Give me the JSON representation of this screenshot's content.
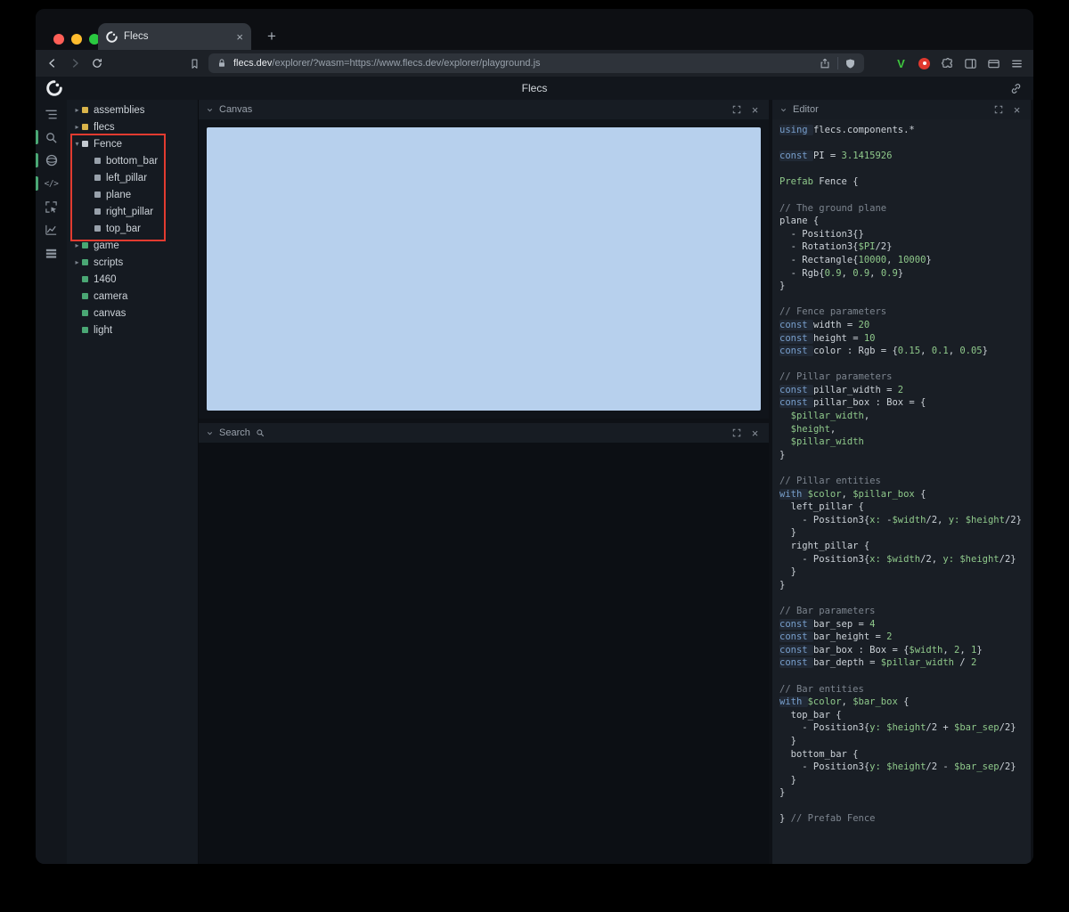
{
  "browser": {
    "tab_title": "Flecs",
    "tab_close_label": "×",
    "new_tab_label": "+",
    "url_domain": "flecs.dev",
    "url_path": "/explorer/?wasm=https://www.flecs.dev/explorer/playground.js",
    "v_extension_label": "V"
  },
  "app": {
    "title": "Flecs"
  },
  "iconbar": [
    {
      "name": "tree-icon",
      "active": false
    },
    {
      "name": "search-icon",
      "active": true
    },
    {
      "name": "scene-icon",
      "active": true
    },
    {
      "name": "code-icon",
      "active": true
    },
    {
      "name": "inspect-icon",
      "active": false
    },
    {
      "name": "chart-icon",
      "active": false
    },
    {
      "name": "rows-icon",
      "active": false
    }
  ],
  "tree": [
    {
      "label": "assemblies",
      "kind": "module",
      "arrow": "collapsed",
      "depth": 0
    },
    {
      "label": "flecs",
      "kind": "module",
      "arrow": "collapsed",
      "depth": 0
    },
    {
      "label": "Fence",
      "kind": "prefab",
      "arrow": "expanded",
      "depth": 0
    },
    {
      "label": "bottom_bar",
      "kind": "child",
      "arrow": "leaf",
      "depth": 1
    },
    {
      "label": "left_pillar",
      "kind": "child",
      "arrow": "leaf",
      "depth": 1
    },
    {
      "label": "plane",
      "kind": "child",
      "arrow": "leaf",
      "depth": 1
    },
    {
      "label": "right_pillar",
      "kind": "child",
      "arrow": "leaf",
      "depth": 1
    },
    {
      "label": "top_bar",
      "kind": "child",
      "arrow": "leaf",
      "depth": 1
    },
    {
      "label": "game",
      "kind": "entity",
      "arrow": "collapsed",
      "depth": 0
    },
    {
      "label": "scripts",
      "kind": "entity",
      "arrow": "collapsed",
      "depth": 0
    },
    {
      "label": "1460",
      "kind": "entity",
      "arrow": "leaf",
      "depth": 0
    },
    {
      "label": "camera",
      "kind": "entity",
      "arrow": "leaf",
      "depth": 0
    },
    {
      "label": "canvas",
      "kind": "entity",
      "arrow": "leaf",
      "depth": 0
    },
    {
      "label": "light",
      "kind": "entity",
      "arrow": "leaf",
      "depth": 0
    }
  ],
  "panels": {
    "canvas": {
      "title": "Canvas"
    },
    "search": {
      "title": "Search"
    },
    "editor": {
      "title": "Editor"
    },
    "close_label": "×"
  },
  "colors": {
    "canvas_bg": "#b7d0ed",
    "annotation": "#e23b30",
    "module_square": "#d9b44a",
    "prefab_square": "#c3c9d0",
    "child_square": "#98a1ab",
    "entity_square": "#4aa774"
  },
  "code": [
    [
      [
        "k",
        "using "
      ],
      [
        "p",
        "flecs.components.*"
      ]
    ],
    [],
    [
      [
        "k",
        "const "
      ],
      [
        "p",
        "PI = "
      ],
      [
        "n",
        "3.1415926"
      ]
    ],
    [],
    [
      [
        "g",
        "Prefab "
      ],
      [
        "p",
        "Fence {"
      ]
    ],
    [],
    [
      [
        "c",
        "// The ground plane"
      ]
    ],
    [
      [
        "p",
        "plane {"
      ]
    ],
    [
      [
        "p",
        "  - Position3{}"
      ]
    ],
    [
      [
        "p",
        "  - Rotation3{"
      ],
      [
        "v",
        "$PI"
      ],
      [
        "p",
        "/2}"
      ]
    ],
    [
      [
        "p",
        "  - Rectangle{"
      ],
      [
        "n",
        "10000"
      ],
      [
        "p",
        ", "
      ],
      [
        "n",
        "10000"
      ],
      [
        "p",
        "}"
      ]
    ],
    [
      [
        "p",
        "  - Rgb{"
      ],
      [
        "n",
        "0.9"
      ],
      [
        "p",
        ", "
      ],
      [
        "n",
        "0.9"
      ],
      [
        "p",
        ", "
      ],
      [
        "n",
        "0.9"
      ],
      [
        "p",
        "}"
      ]
    ],
    [
      [
        "p",
        "}"
      ]
    ],
    [],
    [
      [
        "c",
        "// Fence parameters"
      ]
    ],
    [
      [
        "k",
        "const "
      ],
      [
        "p",
        "width = "
      ],
      [
        "n",
        "20"
      ]
    ],
    [
      [
        "k",
        "const "
      ],
      [
        "p",
        "height = "
      ],
      [
        "n",
        "10"
      ]
    ],
    [
      [
        "k",
        "const "
      ],
      [
        "p",
        "color : Rgb = {"
      ],
      [
        "n",
        "0.15"
      ],
      [
        "p",
        ", "
      ],
      [
        "n",
        "0.1"
      ],
      [
        "p",
        ", "
      ],
      [
        "n",
        "0.05"
      ],
      [
        "p",
        "}"
      ]
    ],
    [],
    [
      [
        "c",
        "// Pillar parameters"
      ]
    ],
    [
      [
        "k",
        "const "
      ],
      [
        "p",
        "pillar_width = "
      ],
      [
        "n",
        "2"
      ]
    ],
    [
      [
        "k",
        "const "
      ],
      [
        "p",
        "pillar_box : Box = {"
      ]
    ],
    [
      [
        "p",
        "  "
      ],
      [
        "v",
        "$pillar_width"
      ],
      [
        "p",
        ","
      ]
    ],
    [
      [
        "p",
        "  "
      ],
      [
        "v",
        "$height"
      ],
      [
        "p",
        ","
      ]
    ],
    [
      [
        "p",
        "  "
      ],
      [
        "v",
        "$pillar_width"
      ]
    ],
    [
      [
        "p",
        "}"
      ]
    ],
    [],
    [
      [
        "c",
        "// Pillar entities"
      ]
    ],
    [
      [
        "k",
        "with "
      ],
      [
        "v",
        "$color"
      ],
      [
        "p",
        ", "
      ],
      [
        "v",
        "$pillar_box"
      ],
      [
        "p",
        " {"
      ]
    ],
    [
      [
        "p",
        "  left_pillar {"
      ]
    ],
    [
      [
        "p",
        "    - Position3{"
      ],
      [
        "v",
        "x:"
      ],
      [
        "p",
        " -"
      ],
      [
        "v",
        "$width"
      ],
      [
        "p",
        "/2, "
      ],
      [
        "v",
        "y:"
      ],
      [
        "p",
        " "
      ],
      [
        "v",
        "$height"
      ],
      [
        "p",
        "/2}"
      ]
    ],
    [
      [
        "p",
        "  }"
      ]
    ],
    [
      [
        "p",
        "  right_pillar {"
      ]
    ],
    [
      [
        "p",
        "    - Position3{"
      ],
      [
        "v",
        "x:"
      ],
      [
        "p",
        " "
      ],
      [
        "v",
        "$width"
      ],
      [
        "p",
        "/2, "
      ],
      [
        "v",
        "y:"
      ],
      [
        "p",
        " "
      ],
      [
        "v",
        "$height"
      ],
      [
        "p",
        "/2}"
      ]
    ],
    [
      [
        "p",
        "  }"
      ]
    ],
    [
      [
        "p",
        "}"
      ]
    ],
    [],
    [
      [
        "c",
        "// Bar parameters"
      ]
    ],
    [
      [
        "k",
        "const "
      ],
      [
        "p",
        "bar_sep = "
      ],
      [
        "n",
        "4"
      ]
    ],
    [
      [
        "k",
        "const "
      ],
      [
        "p",
        "bar_height = "
      ],
      [
        "n",
        "2"
      ]
    ],
    [
      [
        "k",
        "const "
      ],
      [
        "p",
        "bar_box : Box = {"
      ],
      [
        "v",
        "$width"
      ],
      [
        "p",
        ", "
      ],
      [
        "n",
        "2"
      ],
      [
        "p",
        ", "
      ],
      [
        "n",
        "1"
      ],
      [
        "p",
        "}"
      ]
    ],
    [
      [
        "k",
        "const "
      ],
      [
        "p",
        "bar_depth = "
      ],
      [
        "v",
        "$pillar_width"
      ],
      [
        "p",
        " / "
      ],
      [
        "n",
        "2"
      ]
    ],
    [],
    [
      [
        "c",
        "// Bar entities"
      ]
    ],
    [
      [
        "k",
        "with "
      ],
      [
        "v",
        "$color"
      ],
      [
        "p",
        ", "
      ],
      [
        "v",
        "$bar_box"
      ],
      [
        "p",
        " {"
      ]
    ],
    [
      [
        "p",
        "  top_bar {"
      ]
    ],
    [
      [
        "p",
        "    - Position3{"
      ],
      [
        "v",
        "y:"
      ],
      [
        "p",
        " "
      ],
      [
        "v",
        "$height"
      ],
      [
        "p",
        "/2 + "
      ],
      [
        "v",
        "$bar_sep"
      ],
      [
        "p",
        "/2}"
      ]
    ],
    [
      [
        "p",
        "  }"
      ]
    ],
    [
      [
        "p",
        "  bottom_bar {"
      ]
    ],
    [
      [
        "p",
        "    - Position3{"
      ],
      [
        "v",
        "y:"
      ],
      [
        "p",
        " "
      ],
      [
        "v",
        "$height"
      ],
      [
        "p",
        "/2 - "
      ],
      [
        "v",
        "$bar_sep"
      ],
      [
        "p",
        "/2}"
      ]
    ],
    [
      [
        "p",
        "  }"
      ]
    ],
    [
      [
        "p",
        "}"
      ]
    ],
    [],
    [
      [
        "p",
        "} "
      ],
      [
        "c",
        "// Prefab Fence"
      ]
    ]
  ]
}
